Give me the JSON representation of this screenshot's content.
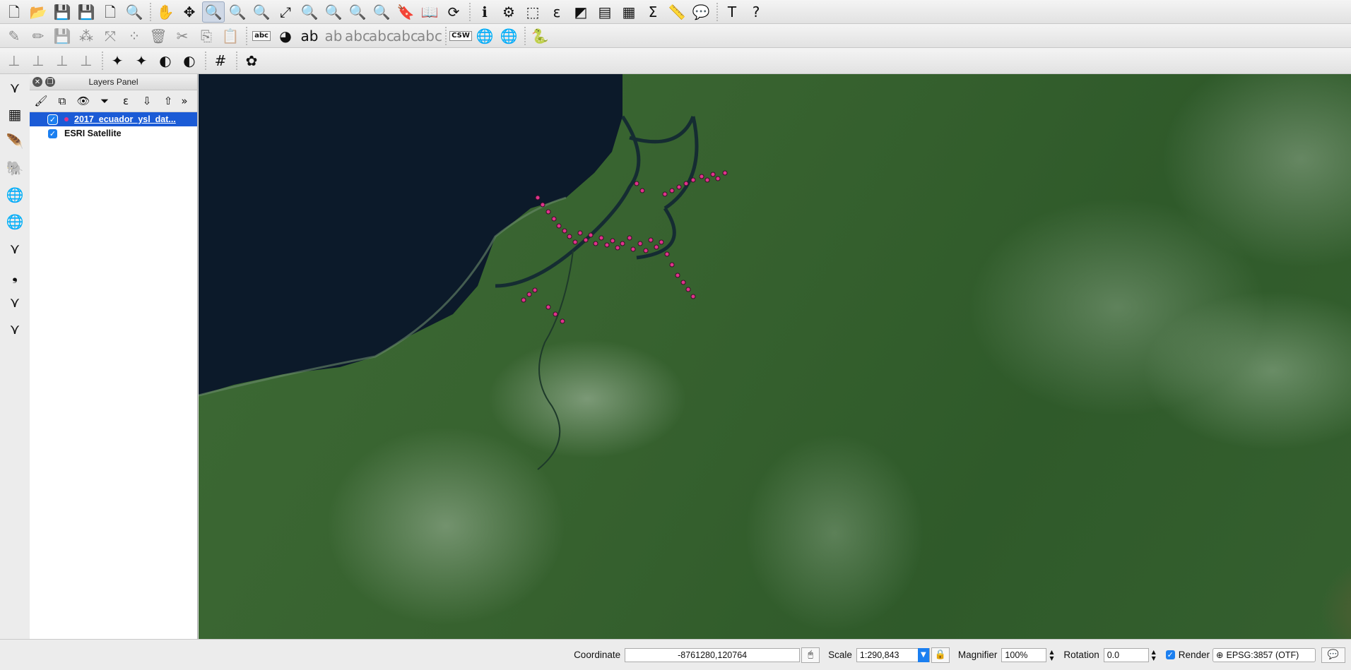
{
  "toolbar1": [
    {
      "name": "new-project-icon",
      "glyph": "🗋"
    },
    {
      "name": "open-project-icon",
      "glyph": "📂"
    },
    {
      "name": "save-project-icon",
      "glyph": "💾"
    },
    {
      "name": "save-as-icon",
      "glyph": "💾"
    },
    {
      "name": "new-print-composer-icon",
      "glyph": "🗋"
    },
    {
      "name": "composer-manager-icon",
      "glyph": "🔍"
    },
    {
      "name": "pan-map-icon",
      "glyph": "✋"
    },
    {
      "name": "pan-to-selection-icon",
      "glyph": "✥"
    },
    {
      "name": "zoom-in-icon",
      "glyph": "🔍",
      "active": true
    },
    {
      "name": "zoom-out-icon",
      "glyph": "🔍"
    },
    {
      "name": "zoom-native-icon",
      "glyph": "🔍"
    },
    {
      "name": "zoom-full-icon",
      "glyph": "⤢"
    },
    {
      "name": "zoom-to-selection-icon",
      "glyph": "🔍"
    },
    {
      "name": "zoom-to-layer-icon",
      "glyph": "🔍"
    },
    {
      "name": "zoom-last-icon",
      "glyph": "🔍"
    },
    {
      "name": "zoom-next-icon",
      "glyph": "🔍"
    },
    {
      "name": "new-bookmark-icon",
      "glyph": "🔖"
    },
    {
      "name": "show-bookmarks-icon",
      "glyph": "📖"
    },
    {
      "name": "refresh-icon",
      "glyph": "⟳"
    },
    {
      "name": "identify-icon",
      "glyph": "ℹ"
    },
    {
      "name": "run-feature-action-icon",
      "glyph": "⚙"
    },
    {
      "name": "select-features-icon",
      "glyph": "⬚"
    },
    {
      "name": "select-by-expression-icon",
      "glyph": "ε"
    },
    {
      "name": "deselect-icon",
      "glyph": "◩"
    },
    {
      "name": "attribute-table-icon",
      "glyph": "▤"
    },
    {
      "name": "statistics-icon",
      "glyph": "▦"
    },
    {
      "name": "field-calculator-icon",
      "glyph": "Σ"
    },
    {
      "name": "measure-icon",
      "glyph": "📏"
    },
    {
      "name": "map-tips-icon",
      "glyph": "💬"
    },
    {
      "name": "text-annotation-icon",
      "glyph": "T"
    },
    {
      "name": "help-icon",
      "glyph": "?"
    }
  ],
  "toolbar2": [
    {
      "name": "current-edits-icon",
      "glyph": "✎",
      "dim": true
    },
    {
      "name": "toggle-editing-icon",
      "glyph": "✏",
      "dim": true
    },
    {
      "name": "save-edits-icon",
      "glyph": "💾",
      "dim": true
    },
    {
      "name": "add-feature-icon",
      "glyph": "⁂",
      "dim": true
    },
    {
      "name": "move-feature-icon",
      "glyph": "⤧",
      "dim": true
    },
    {
      "name": "node-tool-icon",
      "glyph": "⁘",
      "dim": true
    },
    {
      "name": "delete-selected-icon",
      "glyph": "🗑",
      "dim": true
    },
    {
      "name": "cut-features-icon",
      "glyph": "✂",
      "dim": true
    },
    {
      "name": "copy-features-icon",
      "glyph": "⎘",
      "dim": true
    },
    {
      "name": "paste-features-icon",
      "glyph": "📋",
      "dim": true
    },
    {
      "name": "layer-labeling-icon",
      "glyph": "abc",
      "text": true
    },
    {
      "name": "layer-diagram-icon",
      "glyph": "◕"
    },
    {
      "name": "pin-labels-icon",
      "glyph": "ab"
    },
    {
      "name": "highlight-pinned-icon",
      "glyph": "ab",
      "dim": true
    },
    {
      "name": "show-hide-labels-icon",
      "glyph": "abc",
      "dim": true
    },
    {
      "name": "move-label-icon",
      "glyph": "abc",
      "dim": true
    },
    {
      "name": "rotate-label-icon",
      "glyph": "abc",
      "dim": true
    },
    {
      "name": "change-label-icon",
      "glyph": "abc",
      "dim": true
    },
    {
      "name": "csw-icon",
      "glyph": "CSW",
      "text": true
    },
    {
      "name": "metasearch-icon",
      "glyph": "🌐"
    },
    {
      "name": "metasearch-search-icon",
      "glyph": "🌐"
    },
    {
      "name": "python-console-icon",
      "glyph": "🐍"
    }
  ],
  "toolbar3": [
    {
      "name": "digitize-line-icon",
      "glyph": "⊥",
      "dim": true
    },
    {
      "name": "digitize-split-icon",
      "glyph": "⊥",
      "dim": true
    },
    {
      "name": "digitize-merge-icon",
      "glyph": "⊥",
      "dim": true
    },
    {
      "name": "digitize-reshape-icon",
      "glyph": "⊥",
      "dim": true
    },
    {
      "name": "snapping-icon",
      "glyph": "✦"
    },
    {
      "name": "snapping-options-icon",
      "glyph": "✦"
    },
    {
      "name": "gps-icon",
      "glyph": "◐"
    },
    {
      "name": "gps-track-icon",
      "glyph": "◐"
    },
    {
      "name": "grid-icon",
      "glyph": "#"
    },
    {
      "name": "plugin-tool-icon",
      "glyph": "✿"
    }
  ],
  "left_tools": [
    {
      "name": "add-vector-layer-icon",
      "glyph": "⋎"
    },
    {
      "name": "add-raster-layer-icon",
      "glyph": "▦"
    },
    {
      "name": "add-spatialite-layer-icon",
      "glyph": "🪶"
    },
    {
      "name": "add-postgis-layer-icon",
      "glyph": "🐘"
    },
    {
      "name": "add-wms-layer-icon",
      "glyph": "🌐"
    },
    {
      "name": "add-wcs-layer-icon",
      "glyph": "🌐"
    },
    {
      "name": "add-wfs-layer-icon",
      "glyph": "⋎"
    },
    {
      "name": "add-delimited-text-icon",
      "glyph": "❟"
    },
    {
      "name": "new-shapefile-icon",
      "glyph": "⋎"
    },
    {
      "name": "new-spatialite-icon",
      "glyph": "⋎"
    }
  ],
  "layers_panel": {
    "title": "Layers Panel",
    "layers": [
      {
        "label": "2017_ecuador_ysl_dat...",
        "checked": true,
        "selected": true
      },
      {
        "label": "ESRI Satellite",
        "checked": true,
        "selected": false
      }
    ]
  },
  "statusbar": {
    "coordinate_label": "Coordinate",
    "coordinate_value": "-8761280,120764",
    "scale_label": "Scale",
    "scale_value": "1:290,843",
    "magnifier_label": "Magnifier",
    "magnifier_value": "100%",
    "rotation_label": "Rotation",
    "rotation_value": "0.0",
    "render_label": "Render",
    "crs_label": "EPSG:3857 (OTF)"
  },
  "colors": {
    "sea": "#0c1a2a",
    "points": "#e0338b",
    "selection": "#1b5bd6"
  }
}
